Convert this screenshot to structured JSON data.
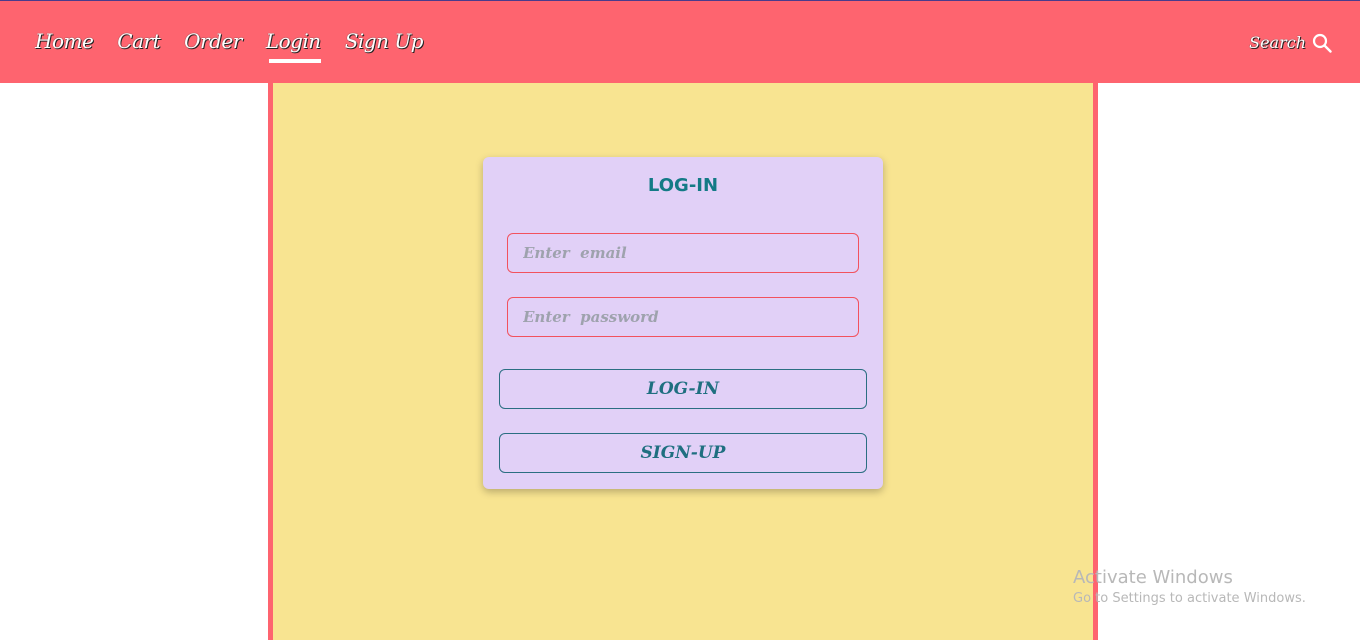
{
  "nav": {
    "links": [
      {
        "label": "Home"
      },
      {
        "label": "Cart"
      },
      {
        "label": "Order"
      },
      {
        "label": "Login"
      },
      {
        "label": "Sign Up"
      }
    ],
    "active": "Login",
    "search_label": "Search",
    "search_icon": "search-icon"
  },
  "login": {
    "title": "LOG-IN",
    "email_placeholder": "Enter  email",
    "email_value": "",
    "password_placeholder": "Enter  password",
    "password_value": "",
    "login_button": "LOG-IN",
    "signup_button": "SIGN-UP"
  },
  "watermark": {
    "title": "Activate Windows",
    "subtitle": "Go to Settings to activate Windows."
  },
  "colors": {
    "navbar": "#fe646f",
    "panel": "#f8e491",
    "card": "#e1d0f7",
    "accent_text": "#137a86",
    "field_border": "#f2525e"
  }
}
